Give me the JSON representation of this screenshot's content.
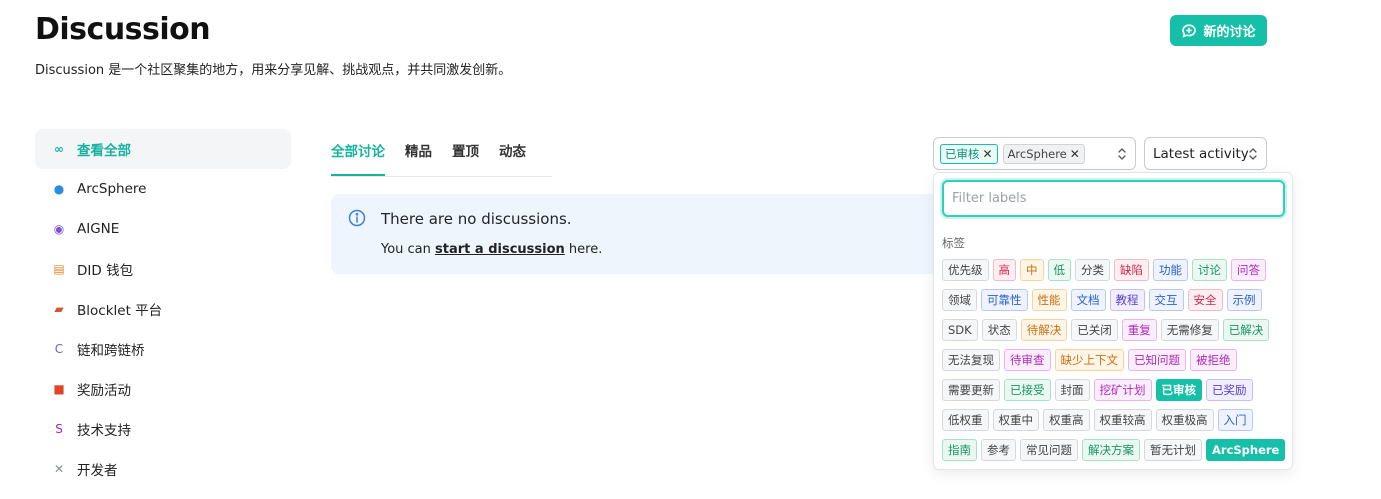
{
  "header": {
    "title": "Discussion",
    "subtitle": "Discussion 是一个社区聚集的地方，用来分享见解、挑战观点，并共同激发创新。",
    "new_button": "新的讨论"
  },
  "sidebar": {
    "items": [
      {
        "label": "查看全部",
        "icon": "infinity-icon",
        "glyph": "∞",
        "color": "#16b3a0"
      },
      {
        "label": "ArcSphere",
        "icon": "globe-icon",
        "glyph": "●",
        "color": "#2a8de0"
      },
      {
        "label": "AIGNE",
        "icon": "robot-icon",
        "glyph": "◉",
        "color": "#7b4fd6"
      },
      {
        "label": "DID 钱包",
        "icon": "wallet-icon",
        "glyph": "▤",
        "color": "#e08a2a"
      },
      {
        "label": "Blocklet 平台",
        "icon": "truck-icon",
        "glyph": "▰",
        "color": "#d9542b"
      },
      {
        "label": "链和跨链桥",
        "icon": "letter-c-icon",
        "glyph": "C",
        "color": "#6b5fd0"
      },
      {
        "label": "奖励活动",
        "icon": "gift-icon",
        "glyph": "■",
        "color": "#e0452a"
      },
      {
        "label": "技术支持",
        "icon": "letter-s-icon",
        "glyph": "S",
        "color": "#9b2ac0"
      },
      {
        "label": "开发者",
        "icon": "tools-icon",
        "glyph": "✕",
        "color": "#8a8f96"
      }
    ]
  },
  "tabs": [
    "全部讨论",
    "精品",
    "置顶",
    "动态"
  ],
  "empty_state": {
    "title": "There are no discussions.",
    "prefix": "You can ",
    "link": "start a discussion",
    "suffix": " here."
  },
  "filters": {
    "selected_labels": [
      {
        "text": "已审核",
        "style": "green"
      },
      {
        "text": "ArcSphere",
        "style": "grey"
      }
    ],
    "sort": "Latest activity",
    "filter_placeholder": "Filter labels",
    "group_label": "标签"
  },
  "colors": {
    "accent": "#16c0a8"
  },
  "labels": [
    [
      {
        "text": "优先级",
        "color": "#444444",
        "bg": "#f6f7f8",
        "border": "#d5d9de"
      },
      {
        "text": "高",
        "color": "#d4254f",
        "bg": "#fdeef1",
        "border": "#f3b9c7"
      },
      {
        "text": "中",
        "color": "#c7700c",
        "bg": "#fff5e6",
        "border": "#f5d3a2"
      },
      {
        "text": "低",
        "color": "#16936a",
        "bg": "#eaf8f1",
        "border": "#a9e0c8"
      },
      {
        "text": "分类",
        "color": "#444444",
        "bg": "#f6f7f8",
        "border": "#d5d9de"
      },
      {
        "text": "缺陷",
        "color": "#d4254f",
        "bg": "#fdeef1",
        "border": "#f3b9c7"
      },
      {
        "text": "功能",
        "color": "#2a5fd0",
        "bg": "#eef3fd",
        "border": "#b6c9f3"
      },
      {
        "text": "讨论",
        "color": "#16936a",
        "bg": "#eaf8f1",
        "border": "#a9e0c8"
      },
      {
        "text": "问答",
        "color": "#b02ab8",
        "bg": "#fbeefc",
        "border": "#e7b4ec"
      }
    ],
    [
      {
        "text": "领域",
        "color": "#444444",
        "bg": "#f6f7f8",
        "border": "#d5d9de"
      },
      {
        "text": "可靠性",
        "color": "#2a5fd0",
        "bg": "#eef3fd",
        "border": "#b6c9f3"
      },
      {
        "text": "性能",
        "color": "#c7700c",
        "bg": "#fff5e6",
        "border": "#f5d3a2"
      },
      {
        "text": "文档",
        "color": "#2a5fd0",
        "bg": "#eef3fd",
        "border": "#b6c9f3"
      },
      {
        "text": "教程",
        "color": "#5a3fd0",
        "bg": "#f2effd",
        "border": "#c9bdf3"
      },
      {
        "text": "交互",
        "color": "#2a5fd0",
        "bg": "#eef3fd",
        "border": "#b6c9f3"
      },
      {
        "text": "安全",
        "color": "#d4254f",
        "bg": "#fdeef1",
        "border": "#f3b9c7"
      },
      {
        "text": "示例",
        "color": "#2a5fd0",
        "bg": "#eef3fd",
        "border": "#b6c9f3"
      }
    ],
    [
      {
        "text": "SDK",
        "color": "#444444",
        "bg": "#f6f7f8",
        "border": "#d5d9de"
      },
      {
        "text": "状态",
        "color": "#444444",
        "bg": "#f6f7f8",
        "border": "#d5d9de"
      },
      {
        "text": "待解决",
        "color": "#c7700c",
        "bg": "#fff5e6",
        "border": "#f5d3a2"
      },
      {
        "text": "已关闭",
        "color": "#444444",
        "bg": "#f6f7f8",
        "border": "#d5d9de"
      },
      {
        "text": "重复",
        "color": "#b02ab8",
        "bg": "#fbeefc",
        "border": "#e7b4ec"
      },
      {
        "text": "无需修复",
        "color": "#444444",
        "bg": "#f6f7f8",
        "border": "#d5d9de"
      },
      {
        "text": "已解决",
        "color": "#16936a",
        "bg": "#eaf8f1",
        "border": "#a9e0c8"
      }
    ],
    [
      {
        "text": "无法复现",
        "color": "#444444",
        "bg": "#f6f7f8",
        "border": "#d5d9de"
      },
      {
        "text": "待审查",
        "color": "#b02ab8",
        "bg": "#fbeefc",
        "border": "#e7b4ec"
      },
      {
        "text": "缺少上下文",
        "color": "#c7700c",
        "bg": "#fff5e6",
        "border": "#f5d3a2"
      },
      {
        "text": "已知问题",
        "color": "#b02ab8",
        "bg": "#fbeefc",
        "border": "#e7b4ec"
      },
      {
        "text": "被拒绝",
        "color": "#b02ab8",
        "bg": "#fbeefc",
        "border": "#e7b4ec"
      }
    ],
    [
      {
        "text": "需要更新",
        "color": "#444444",
        "bg": "#f6f7f8",
        "border": "#d5d9de"
      },
      {
        "text": "已接受",
        "color": "#16936a",
        "bg": "#eaf8f1",
        "border": "#a9e0c8"
      },
      {
        "text": "封面",
        "color": "#444444",
        "bg": "#f6f7f8",
        "border": "#d5d9de"
      },
      {
        "text": "挖矿计划",
        "color": "#b02ab8",
        "bg": "#fbeefc",
        "border": "#e7b4ec"
      },
      {
        "text": "已审核",
        "selected": true
      },
      {
        "text": "已奖励",
        "color": "#5a3fd0",
        "bg": "#f2effd",
        "border": "#c9bdf3"
      }
    ],
    [
      {
        "text": "低权重",
        "color": "#444444",
        "bg": "#f6f7f8",
        "border": "#d5d9de"
      },
      {
        "text": "权重中",
        "color": "#444444",
        "bg": "#f6f7f8",
        "border": "#d5d9de"
      },
      {
        "text": "权重高",
        "color": "#444444",
        "bg": "#f6f7f8",
        "border": "#d5d9de"
      },
      {
        "text": "权重较高",
        "color": "#444444",
        "bg": "#f6f7f8",
        "border": "#d5d9de"
      },
      {
        "text": "权重极高",
        "color": "#444444",
        "bg": "#f6f7f8",
        "border": "#d5d9de"
      },
      {
        "text": "入门",
        "color": "#2a5fd0",
        "bg": "#eef3fd",
        "border": "#b6c9f3"
      }
    ],
    [
      {
        "text": "指南",
        "color": "#16936a",
        "bg": "#eaf8f1",
        "border": "#a9e0c8"
      },
      {
        "text": "参考",
        "color": "#444444",
        "bg": "#f6f7f8",
        "border": "#d5d9de"
      },
      {
        "text": "常见问题",
        "color": "#444444",
        "bg": "#f6f7f8",
        "border": "#d5d9de"
      },
      {
        "text": "解决方案",
        "color": "#16936a",
        "bg": "#eaf8f1",
        "border": "#a9e0c8"
      },
      {
        "text": "暂无计划",
        "color": "#444444",
        "bg": "#f6f7f8",
        "border": "#d5d9de"
      },
      {
        "text": "ArcSphere",
        "selected": true
      }
    ]
  ]
}
